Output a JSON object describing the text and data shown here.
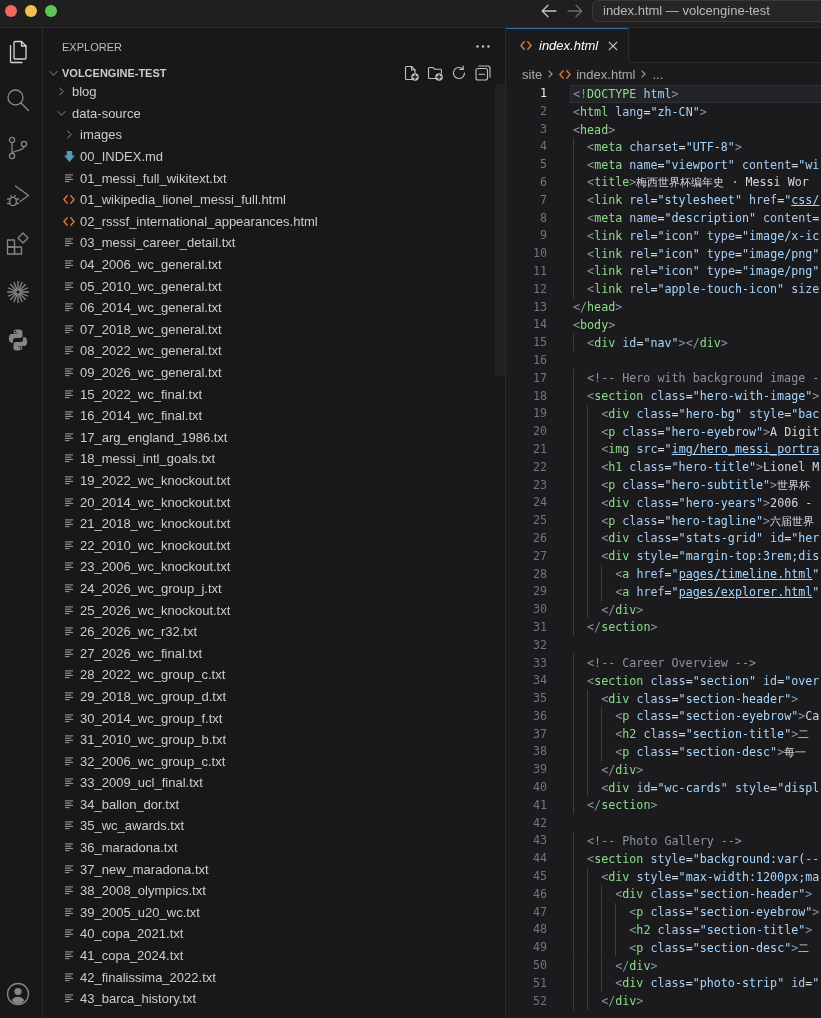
{
  "window": {
    "title": "index.html — volcengine-test",
    "nav": [
      {
        "kind": "back",
        "disabled": false
      },
      {
        "kind": "forward",
        "disabled": true
      }
    ]
  },
  "activity_bar": {
    "items": [
      {
        "kind": "files",
        "selected": true
      },
      {
        "kind": "search",
        "selected": false
      },
      {
        "kind": "source-control",
        "selected": false
      },
      {
        "kind": "run-debug",
        "selected": false
      },
      {
        "kind": "extensions",
        "selected": false
      },
      {
        "kind": "sparkle",
        "selected": false
      },
      {
        "kind": "python",
        "selected": false
      }
    ],
    "bottom": [
      {
        "kind": "account"
      }
    ]
  },
  "sidebar": {
    "title": "EXPLORER",
    "tree": {
      "label": "VOLCENGINE-TEST",
      "expanded": true,
      "children": [
        {
          "label": "blog",
          "kind": "folder",
          "expanded": false
        },
        {
          "label": "data-source",
          "kind": "folder",
          "expanded": true,
          "children": [
            {
              "label": "images",
              "kind": "folder",
              "expanded": false
            },
            {
              "label": "00_INDEX.md",
              "kind": "markdown"
            },
            {
              "label": "01_messi_full_wikitext.txt",
              "kind": "text"
            },
            {
              "label": "01_wikipedia_lionel_messi_full.html",
              "kind": "html"
            },
            {
              "label": "02_rsssf_international_appearances.html",
              "kind": "html"
            },
            {
              "label": "03_messi_career_detail.txt",
              "kind": "text"
            },
            {
              "label": "04_2006_wc_general.txt",
              "kind": "text"
            },
            {
              "label": "05_2010_wc_general.txt",
              "kind": "text"
            },
            {
              "label": "06_2014_wc_general.txt",
              "kind": "text"
            },
            {
              "label": "07_2018_wc_general.txt",
              "kind": "text"
            },
            {
              "label": "08_2022_wc_general.txt",
              "kind": "text"
            },
            {
              "label": "09_2026_wc_general.txt",
              "kind": "text"
            },
            {
              "label": "15_2022_wc_final.txt",
              "kind": "text"
            },
            {
              "label": "16_2014_wc_final.txt",
              "kind": "text"
            },
            {
              "label": "17_arg_england_1986.txt",
              "kind": "text"
            },
            {
              "label": "18_messi_intl_goals.txt",
              "kind": "text"
            },
            {
              "label": "19_2022_wc_knockout.txt",
              "kind": "text"
            },
            {
              "label": "20_2014_wc_knockout.txt",
              "kind": "text"
            },
            {
              "label": "21_2018_wc_knockout.txt",
              "kind": "text"
            },
            {
              "label": "22_2010_wc_knockout.txt",
              "kind": "text"
            },
            {
              "label": "23_2006_wc_knockout.txt",
              "kind": "text"
            },
            {
              "label": "24_2026_wc_group_j.txt",
              "kind": "text"
            },
            {
              "label": "25_2026_wc_knockout.txt",
              "kind": "text"
            },
            {
              "label": "26_2026_wc_r32.txt",
              "kind": "text"
            },
            {
              "label": "27_2026_wc_final.txt",
              "kind": "text"
            },
            {
              "label": "28_2022_wc_group_c.txt",
              "kind": "text"
            },
            {
              "label": "29_2018_wc_group_d.txt",
              "kind": "text"
            },
            {
              "label": "30_2014_wc_group_f.txt",
              "kind": "text"
            },
            {
              "label": "31_2010_wc_group_b.txt",
              "kind": "text"
            },
            {
              "label": "32_2006_wc_group_c.txt",
              "kind": "text"
            },
            {
              "label": "33_2009_ucl_final.txt",
              "kind": "text"
            },
            {
              "label": "34_ballon_dor.txt",
              "kind": "text"
            },
            {
              "label": "35_wc_awards.txt",
              "kind": "text"
            },
            {
              "label": "36_maradona.txt",
              "kind": "text"
            },
            {
              "label": "37_new_maradona.txt",
              "kind": "text"
            },
            {
              "label": "38_2008_olympics.txt",
              "kind": "text"
            },
            {
              "label": "39_2005_u20_wc.txt",
              "kind": "text"
            },
            {
              "label": "40_copa_2021.txt",
              "kind": "text"
            },
            {
              "label": "41_copa_2024.txt",
              "kind": "text"
            },
            {
              "label": "42_finalissima_2022.txt",
              "kind": "text"
            },
            {
              "label": "43_barca_history.txt",
              "kind": "text"
            }
          ]
        }
      ]
    }
  },
  "editor": {
    "tabs": [
      {
        "label": "index.html",
        "kind": "html",
        "selected": true,
        "preview": true
      }
    ],
    "breadcrumbs": [
      {
        "label": "site",
        "kind": "folder"
      },
      {
        "label": "index.html",
        "kind": "html"
      },
      {
        "label": "...",
        "kind": "symbols"
      }
    ],
    "lines": [
      {
        "number": "1",
        "code": "<!DOCTYPE html>",
        "current": true,
        "link": false
      },
      {
        "number": "2",
        "code": "<html lang=\"zh-CN\">",
        "current": false,
        "link": false
      },
      {
        "number": "3",
        "code": "<head>",
        "current": false,
        "link": false
      },
      {
        "number": "4",
        "code": "  <meta charset=\"UTF-8\">",
        "current": false,
        "link": false
      },
      {
        "number": "5",
        "code": "  <meta name=\"viewport\" content=\"wi",
        "current": false,
        "link": false
      },
      {
        "number": "6",
        "code": "  <title>梅西世界杯编年史 · Messi Wor",
        "current": false,
        "link": false
      },
      {
        "number": "7",
        "code": "  <link rel=\"stylesheet\" href=\"css/",
        "current": false,
        "link": true
      },
      {
        "number": "8",
        "code": "  <meta name=\"description\" content=",
        "current": false,
        "link": false
      },
      {
        "number": "9",
        "code": "  <link rel=\"icon\" type=\"image/x-ic",
        "current": false,
        "link": false
      },
      {
        "number": "10",
        "code": "  <link rel=\"icon\" type=\"image/png\"",
        "current": false,
        "link": false
      },
      {
        "number": "11",
        "code": "  <link rel=\"icon\" type=\"image/png\"",
        "current": false,
        "link": false
      },
      {
        "number": "12",
        "code": "  <link rel=\"apple-touch-icon\" size",
        "current": false,
        "link": false
      },
      {
        "number": "13",
        "code": "</head>",
        "current": false,
        "link": false
      },
      {
        "number": "14",
        "code": "<body>",
        "current": false,
        "link": false
      },
      {
        "number": "15",
        "code": "  <div id=\"nav\"></div>",
        "current": false,
        "link": false
      },
      {
        "number": "16",
        "current": false
      },
      {
        "number": "17",
        "code": "  <!-- Hero with background image -",
        "current": false,
        "link": false
      },
      {
        "number": "18",
        "code": "  <section class=\"hero-with-image\">",
        "current": false,
        "link": false
      },
      {
        "number": "19",
        "code": "    <div class=\"hero-bg\" style=\"bac",
        "current": false,
        "link": false
      },
      {
        "number": "20",
        "code": "    <p class=\"hero-eyebrow\">A Digit",
        "current": false,
        "link": false
      },
      {
        "number": "21",
        "code": "    <img src=\"img/hero_messi_portra",
        "current": false,
        "link": true
      },
      {
        "number": "22",
        "code": "    <h1 class=\"hero-title\">Lionel M",
        "current": false,
        "link": false
      },
      {
        "number": "23",
        "code": "    <p class=\"hero-subtitle\">世界杯",
        "current": false,
        "link": false
      },
      {
        "number": "24",
        "code": "    <div class=\"hero-years\">2006 -",
        "current": false,
        "link": false
      },
      {
        "number": "25",
        "code": "    <p class=\"hero-tagline\">六届世界",
        "current": false,
        "link": false
      },
      {
        "number": "26",
        "code": "    <div class=\"stats-grid\" id=\"her",
        "current": false,
        "link": false
      },
      {
        "number": "27",
        "code": "    <div style=\"margin-top:3rem;dis",
        "current": false,
        "link": false
      },
      {
        "number": "28",
        "code": "      <a href=\"pages/timeline.html\"",
        "current": false,
        "link": true
      },
      {
        "number": "29",
        "code": "      <a href=\"pages/explorer.html\"",
        "current": false,
        "link": true
      },
      {
        "number": "30",
        "code": "    </div>",
        "current": false,
        "link": false
      },
      {
        "number": "31",
        "code": "  </section>",
        "current": false,
        "link": false
      },
      {
        "number": "32",
        "current": false
      },
      {
        "number": "33",
        "code": "  <!-- Career Overview -->",
        "current": false,
        "link": false
      },
      {
        "number": "34",
        "code": "  <section class=\"section\" id=\"over",
        "current": false,
        "link": false
      },
      {
        "number": "35",
        "code": "    <div class=\"section-header\">",
        "current": false,
        "link": false
      },
      {
        "number": "36",
        "code": "      <p class=\"section-eyebrow\">Ca",
        "current": false,
        "link": false
      },
      {
        "number": "37",
        "code": "      <h2 class=\"section-title\">二",
        "current": false,
        "link": false
      },
      {
        "number": "38",
        "code": "      <p class=\"section-desc\">每一",
        "current": false,
        "link": false
      },
      {
        "number": "39",
        "code": "    </div>",
        "current": false,
        "link": false
      },
      {
        "number": "40",
        "code": "    <div id=\"wc-cards\" style=\"displ",
        "current": false,
        "link": false
      },
      {
        "number": "41",
        "code": "  </section>",
        "current": false,
        "link": false
      },
      {
        "number": "42",
        "current": false
      },
      {
        "number": "43",
        "code": "  <!-- Photo Gallery -->",
        "current": false,
        "link": false
      },
      {
        "number": "44",
        "code": "  <section style=\"background:var(--",
        "current": false,
        "link": false
      },
      {
        "number": "45",
        "code": "    <div style=\"max-width:1200px;ma",
        "current": false,
        "link": false
      },
      {
        "number": "46",
        "code": "      <div class=\"section-header\">",
        "current": false,
        "link": false
      },
      {
        "number": "47",
        "code": "        <p class=\"section-eyebrow\">",
        "current": false,
        "link": false
      },
      {
        "number": "48",
        "code": "        <h2 class=\"section-title\">",
        "current": false,
        "link": false
      },
      {
        "number": "49",
        "code": "        <p class=\"section-desc\">二",
        "current": false,
        "link": false
      },
      {
        "number": "50",
        "code": "      </div>",
        "current": false,
        "link": false
      },
      {
        "number": "51",
        "code": "      <div class=\"photo-strip\" id=\"",
        "current": false,
        "link": false
      },
      {
        "number": "52",
        "code": "    </div>",
        "current": false,
        "link": false
      }
    ]
  }
}
